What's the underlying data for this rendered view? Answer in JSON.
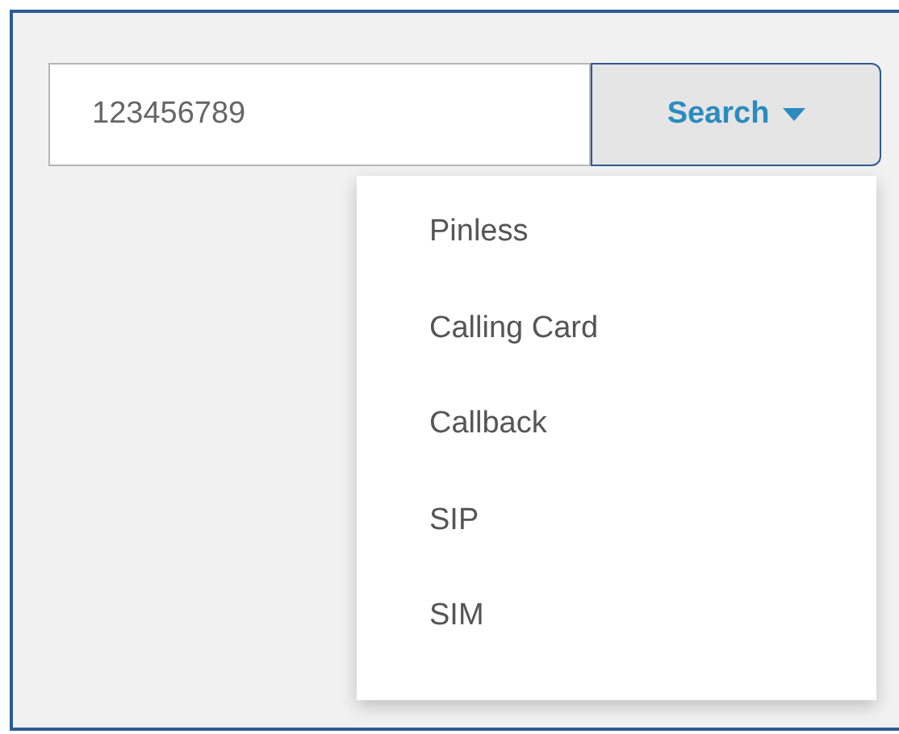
{
  "search": {
    "value": "123456789"
  },
  "search_button": {
    "label": "Search",
    "expanded": true
  },
  "menu": {
    "items": [
      {
        "label": "Pinless"
      },
      {
        "label": "Calling Card"
      },
      {
        "label": "Callback"
      },
      {
        "label": "SIP"
      },
      {
        "label": "SIM"
      }
    ]
  }
}
